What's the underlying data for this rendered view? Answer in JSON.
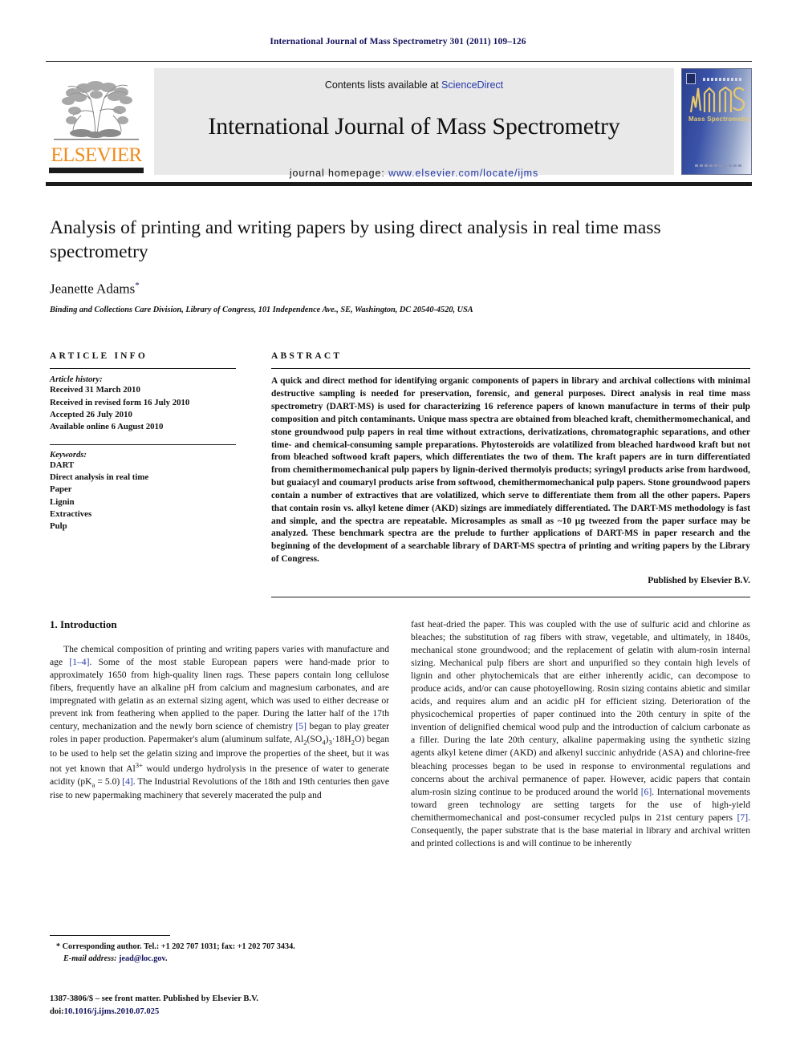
{
  "running_head": "International Journal of Mass Spectrometry 301 (2011) 109–126",
  "masthead": {
    "contents_prefix": "Contents lists available at ",
    "contents_link": "ScienceDirect",
    "journal_title": "International Journal of Mass Spectrometry",
    "homepage_label": "journal homepage:",
    "homepage_url": "www.elsevier.com/locate/ijms",
    "publisher_logo_text": "ELSEVIER",
    "cover_subtitle": "Mass Spectrometry",
    "accent_orange": "#f08c1b",
    "link_blue": "#2437a8"
  },
  "article": {
    "title": "Analysis of printing and writing papers by using direct analysis in real time mass spectrometry",
    "author": "Jeanette Adams",
    "author_marker": "*",
    "affiliation": "Binding and Collections Care Division, Library of Congress, 101 Independence Ave., SE, Washington, DC 20540-4520, USA"
  },
  "article_info": {
    "heading": "ARTICLE INFO",
    "history_label": "Article history:",
    "history": [
      "Received 31 March 2010",
      "Received in revised form 16 July 2010",
      "Accepted 26 July 2010",
      "Available online 6 August 2010"
    ],
    "keywords_label": "Keywords:",
    "keywords": [
      "DART",
      "Direct analysis in real time",
      "Paper",
      "Lignin",
      "Extractives",
      "Pulp"
    ]
  },
  "abstract": {
    "heading": "ABSTRACT",
    "text": "A quick and direct method for identifying organic components of papers in library and archival collections with minimal destructive sampling is needed for preservation, forensic, and general purposes. Direct analysis in real time mass spectrometry (DART-MS) is used for characterizing 16 reference papers of known manufacture in terms of their pulp composition and pitch contaminants. Unique mass spectra are obtained from bleached kraft, chemithermomechanical, and stone groundwood pulp papers in real time without extractions, derivatizations, chromatographic separations, and other time- and chemical-consuming sample preparations. Phytosteroids are volatilized from bleached hardwood kraft but not from bleached softwood kraft papers, which differentiates the two of them. The kraft papers are in turn differentiated from chemithermomechanical pulp papers by lignin-derived thermolyis products; syringyl products arise from hardwood, but guaiacyl and coumaryl products arise from softwood, chemithermomechanical pulp papers. Stone groundwood papers contain a number of extractives that are volatilized, which serve to differentiate them from all the other papers. Papers that contain rosin vs. alkyl ketene dimer (AKD) sizings are immediately differentiated. The DART-MS methodology is fast and simple, and the spectra are repeatable. Microsamples as small as ~10 µg tweezed from the paper surface may be analyzed. These benchmark spectra are the prelude to further applications of DART-MS in paper research and the beginning of the development of a searchable library of DART-MS spectra of printing and writing papers by the Library of Congress.",
    "published_by": "Published by Elsevier B.V."
  },
  "introduction": {
    "heading": "1. Introduction",
    "left_para_1_a": "The chemical composition of printing and writing papers varies with manufacture and age ",
    "ref_1_4": "[1–4]",
    "left_para_1_b": ". Some of the most stable European papers were hand-made prior to approximately 1650 from high-quality linen rags. These papers contain long cellulose fibers, frequently have an alkaline pH from calcium and magnesium carbonates, and are impregnated with gelatin as an external sizing agent, which was used to either decrease or prevent ink from feathering when applied to the paper. During the latter half of the 17th century, mechanization and the newly born science of chemistry ",
    "ref_5": "[5]",
    "left_para_1_c": " began to play greater roles in paper production. Papermaker's alum (aluminum sulfate, Al",
    "left_para_1_d": "(SO",
    "left_para_1_e": ")",
    "left_para_1_f": "·18H",
    "left_para_1_g": "O) began to be used to help set the gelatin sizing and improve the properties of the sheet, but it was not yet known that Al",
    "left_para_1_h": " would undergo hydrolysis in the presence of water to generate acidity (pK",
    "left_para_1_i": " = 5.0) ",
    "ref_4": "[4]",
    "left_para_1_j": ". The Industrial Revolutions of the 18th and 19th centuries then gave rise to new papermaking machinery that severely macerated the pulp and",
    "sub_2": "2",
    "sub_4": "4",
    "sub_3": "3",
    "sub_18H": "2",
    "sup_3plus": "3+",
    "sub_a": "a",
    "right_para_a": "fast heat-dried the paper. This was coupled with the use of sulfuric acid and chlorine as bleaches; the substitution of rag fibers with straw, vegetable, and ultimately, in 1840s, mechanical stone groundwood; and the replacement of gelatin with alum-rosin internal sizing. Mechanical pulp fibers are short and unpurified so they contain high levels of lignin and other phytochemicals that are either inherently acidic, can decompose to produce acids, and/or can cause photoyellowing. Rosin sizing contains abietic and similar acids, and requires alum and an acidic pH for efficient sizing. Deterioration of the physicochemical properties of paper continued into the 20th century in spite of the invention of delignified chemical wood pulp and the introduction of calcium carbonate as a filler. During the late 20th century, alkaline papermaking using the synthetic sizing agents alkyl ketene dimer (AKD) and alkenyl succinic anhydride (ASA) and chlorine-free bleaching processes began to be used in response to environmental regulations and concerns about the archival permanence of paper. However, acidic papers that contain alum-rosin sizing continue to be produced around the world ",
    "ref_6": "[6]",
    "right_para_b": ". International movements toward green technology are setting targets for the use of high-yield chemithermomechanical and post-consumer recycled pulps in 21st century papers ",
    "ref_7": "[7]",
    "right_para_c": ". Consequently, the paper substrate that is the base material in library and archival written and printed collections is and will continue to be inherently"
  },
  "footnote": {
    "marker": "*",
    "corresponding": " Corresponding author. Tel.: +1 202 707 1031; fax: +1 202 707 3434.",
    "email_label": "E-mail address:",
    "email": "jead@loc.gov",
    "email_suffix": "."
  },
  "imprint": {
    "line1": "1387-3806/$ – see front matter. Published by Elsevier B.V.",
    "doi_label": "doi:",
    "doi": "10.1016/j.ijms.2010.07.025"
  }
}
